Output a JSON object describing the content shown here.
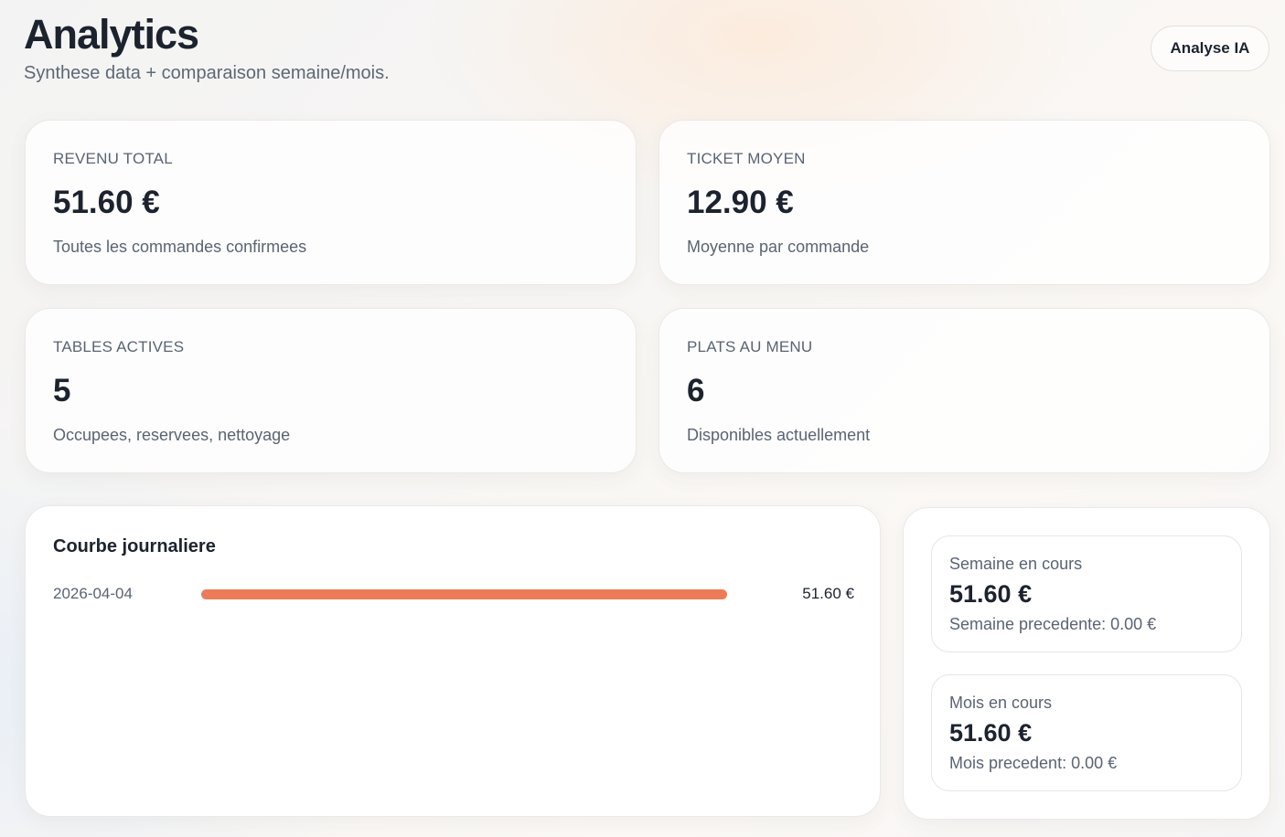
{
  "header": {
    "title": "Analytics",
    "subtitle": "Synthese data + comparaison semaine/mois.",
    "ai_button_label": "Analyse IA"
  },
  "stats": {
    "revenue": {
      "label": "REVENU TOTAL",
      "value": "51.60 €",
      "description": "Toutes les commandes confirmees"
    },
    "ticket": {
      "label": "TICKET MOYEN",
      "value": "12.90 €",
      "description": "Moyenne par commande"
    },
    "tables": {
      "label": "TABLES ACTIVES",
      "value": "5",
      "description": "Occupees, reservees, nettoyage"
    },
    "plats": {
      "label": "PLATS AU MENU",
      "value": "6",
      "description": "Disponibles actuellement"
    }
  },
  "daily_chart": {
    "title": "Courbe journaliere",
    "rows": [
      {
        "date": "2026-04-04",
        "amount_label": "51.60 €",
        "fill_fraction": 1.0
      }
    ],
    "bar_color": "#ec7b5a"
  },
  "comparison": {
    "week": {
      "label": "Semaine en cours",
      "value": "51.60 €",
      "previous": "Semaine precedente: 0.00 €"
    },
    "month": {
      "label": "Mois en cours",
      "value": "51.60 €",
      "previous": "Mois precedent: 0.00 €"
    }
  }
}
